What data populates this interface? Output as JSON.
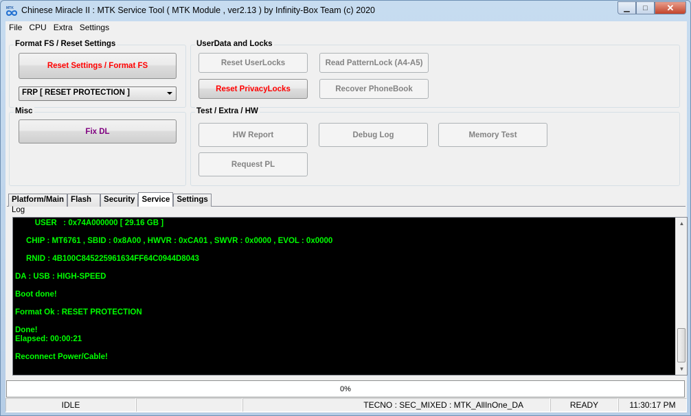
{
  "window": {
    "title": "Chinese Miracle II : MTK Service Tool ( MTK Module , ver2.13  ) by Infinity-Box Team (c) 2020",
    "min_glyph": "▁",
    "max_glyph": "□",
    "close_glyph": "✕"
  },
  "menu": [
    "File",
    "CPU",
    "Extra",
    "Settings"
  ],
  "format_group": {
    "title": "Format FS / Reset Settings",
    "reset_button": "Reset Settings / Format FS",
    "frp_select": "FRP [ RESET PROTECTION ]"
  },
  "misc_group": {
    "title": "Misc",
    "fix_dl_button": "Fix DL"
  },
  "locks_group": {
    "title": "UserData  and Locks",
    "reset_userlocks": "Reset UserLocks",
    "read_patternlock": "Read PatternLock (A4-A5)",
    "reset_privacylocks": "Reset PrivacyLocks",
    "recover_phonebook": "Recover PhoneBook"
  },
  "test_group": {
    "title": "Test / Extra / HW",
    "hw_report": "HW Report",
    "debug_log": "Debug Log",
    "memory_test": "Memory Test",
    "request_pl": "Request PL"
  },
  "tabs": [
    "Platform/Main",
    "Flash",
    "Security",
    "Service",
    "Settings"
  ],
  "active_tab": "Service",
  "log": {
    "label": "Log",
    "lines": [
      "         USER   : 0x74A000000 [ 29.16 GB ]",
      "",
      "     CHIP : MT6761 , SBID : 0x8A00 , HWVR : 0xCA01 , SWVR : 0x0000 , EVOL : 0x0000",
      "",
      "     RNID : 4B100C845225961634FF64C0944D8043",
      "",
      "DA : USB : HIGH-SPEED",
      "",
      "Boot done!",
      "",
      "Format Ok : RESET PROTECTION",
      "",
      "Done!",
      "Elapsed: 00:00:21",
      "",
      "Reconnect Power/Cable!"
    ]
  },
  "progress": {
    "text": "0%",
    "value": 0
  },
  "status": {
    "state": "IDLE",
    "device": "TECNO : SEC_MIXED : MTK_AllInOne_DA",
    "ready": "READY",
    "time": "11:30:17 PM"
  },
  "colors": {
    "log_text": "#00ff00",
    "log_bg": "#000000",
    "red_button_text": "#ff0000",
    "purple_button_text": "#800080"
  }
}
